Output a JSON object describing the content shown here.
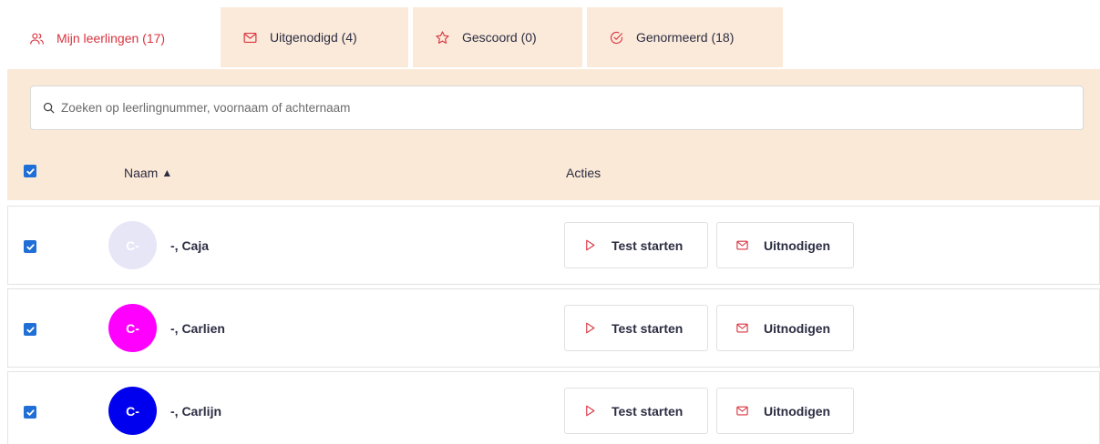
{
  "tabs": [
    {
      "label": "Mijn leerlingen (17)",
      "icon": "users-icon",
      "active": true
    },
    {
      "label": "Uitgenodigd (4)",
      "icon": "envelope-icon",
      "active": false
    },
    {
      "label": "Gescoord (0)",
      "icon": "star-icon",
      "active": false
    },
    {
      "label": "Genormeerd (18)",
      "icon": "check-circle-icon",
      "active": false
    }
  ],
  "search": {
    "placeholder": "Zoeken op leerlingnummer, voornaam of achternaam",
    "value": ""
  },
  "table": {
    "select_all": true,
    "col_name": "Naam",
    "sort_indicator": "▲",
    "col_actions": "Acties"
  },
  "students": [
    {
      "initials": "C-",
      "name": "-, Caja",
      "avatar_color": "#e6e6f7",
      "checked": true,
      "start_label": "Test starten",
      "invite_label": "Uitnodigen"
    },
    {
      "initials": "C-",
      "name": "-, Carlien",
      "avatar_color": "#ff00ff",
      "checked": true,
      "start_label": "Test starten",
      "invite_label": "Uitnodigen"
    },
    {
      "initials": "C-",
      "name": "-, Carlijn",
      "avatar_color": "#0000ee",
      "checked": true,
      "start_label": "Test starten",
      "invite_label": "Uitnodigen"
    }
  ],
  "colors": {
    "accent": "#d9343f",
    "panel_bg": "#fbe9d7",
    "checkbox": "#1f6fd6"
  }
}
